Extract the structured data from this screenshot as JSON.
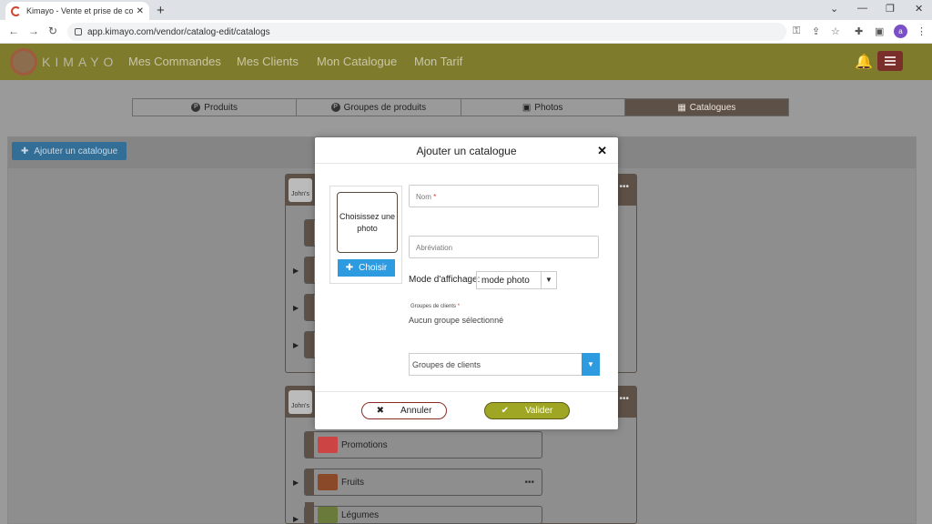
{
  "browser": {
    "tab_title": "Kimayo - Vente et prise de comm",
    "url": "app.kimayo.com/vendor/catalog-edit/catalogs",
    "profile_initial": "a"
  },
  "header": {
    "logo_text": "KIMAYO",
    "nav": [
      "Mes Commandes",
      "Mes Clients",
      "Mon Catalogue",
      "Mon Tarif"
    ]
  },
  "segments": {
    "items": [
      {
        "icon": "P",
        "label": "Produits"
      },
      {
        "icon": "P",
        "label": "Groupes de produits"
      },
      {
        "icon": "▣",
        "label": "Photos"
      },
      {
        "icon": "▦",
        "label": "Catalogues"
      }
    ]
  },
  "toolbar": {
    "add_catalog_label": "Ajouter un catalogue"
  },
  "cards": {
    "avatar_text": "John's"
  },
  "rows": {
    "r1": "Promotions",
    "r2": "Fruits",
    "r3": "Légumes"
  },
  "modal": {
    "title": "Ajouter un catalogue",
    "photo_prompt": "Choisissez une photo",
    "choose_label": "Choisir",
    "name_placeholder": "Nom",
    "required_mark": "*",
    "abbr_placeholder": "Abréviation",
    "display_mode_label": "Mode d'affichage:",
    "display_mode_value": "mode photo",
    "client_groups_label": "Groupes de clients",
    "client_groups_empty": "Aucun groupe sélectionné",
    "client_groups_select": "Groupes de clients",
    "cancel_label": "Annuler",
    "ok_label": "Valider"
  },
  "colors": {
    "header": "#7f7b2d",
    "accent_blue": "#2e9ae0",
    "valider": "#9fa624",
    "cancel_border": "#8a2a25"
  }
}
